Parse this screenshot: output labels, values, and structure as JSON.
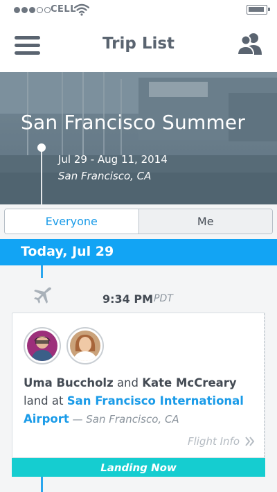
{
  "status_bar": {
    "carrier": "CELL",
    "signal_bars": 3,
    "signal_total": 5
  },
  "nav": {
    "title": "Trip List"
  },
  "trip": {
    "title": "San Francisco Summer",
    "dates": "Jul 29 - Aug 11, 2014",
    "location": "San Francisco, CA"
  },
  "filter": {
    "options": [
      "Everyone",
      "Me"
    ],
    "selected": "Everyone"
  },
  "day": {
    "label": "Today,  Jul 29"
  },
  "event": {
    "time": "9:34 PM",
    "timezone": "PDT",
    "traveler_1": "Uma Buccholz",
    "connector": " and ",
    "traveler_2": "Kate McCreary",
    "action": "land at",
    "place": "San Francisco International Airport",
    "place_location": " — San Francisco, CA",
    "info_link": "Flight Info",
    "status": "Landing Now"
  },
  "colors": {
    "accent": "#12a4f4",
    "link": "#1a9be8",
    "status": "#15cdd0"
  }
}
